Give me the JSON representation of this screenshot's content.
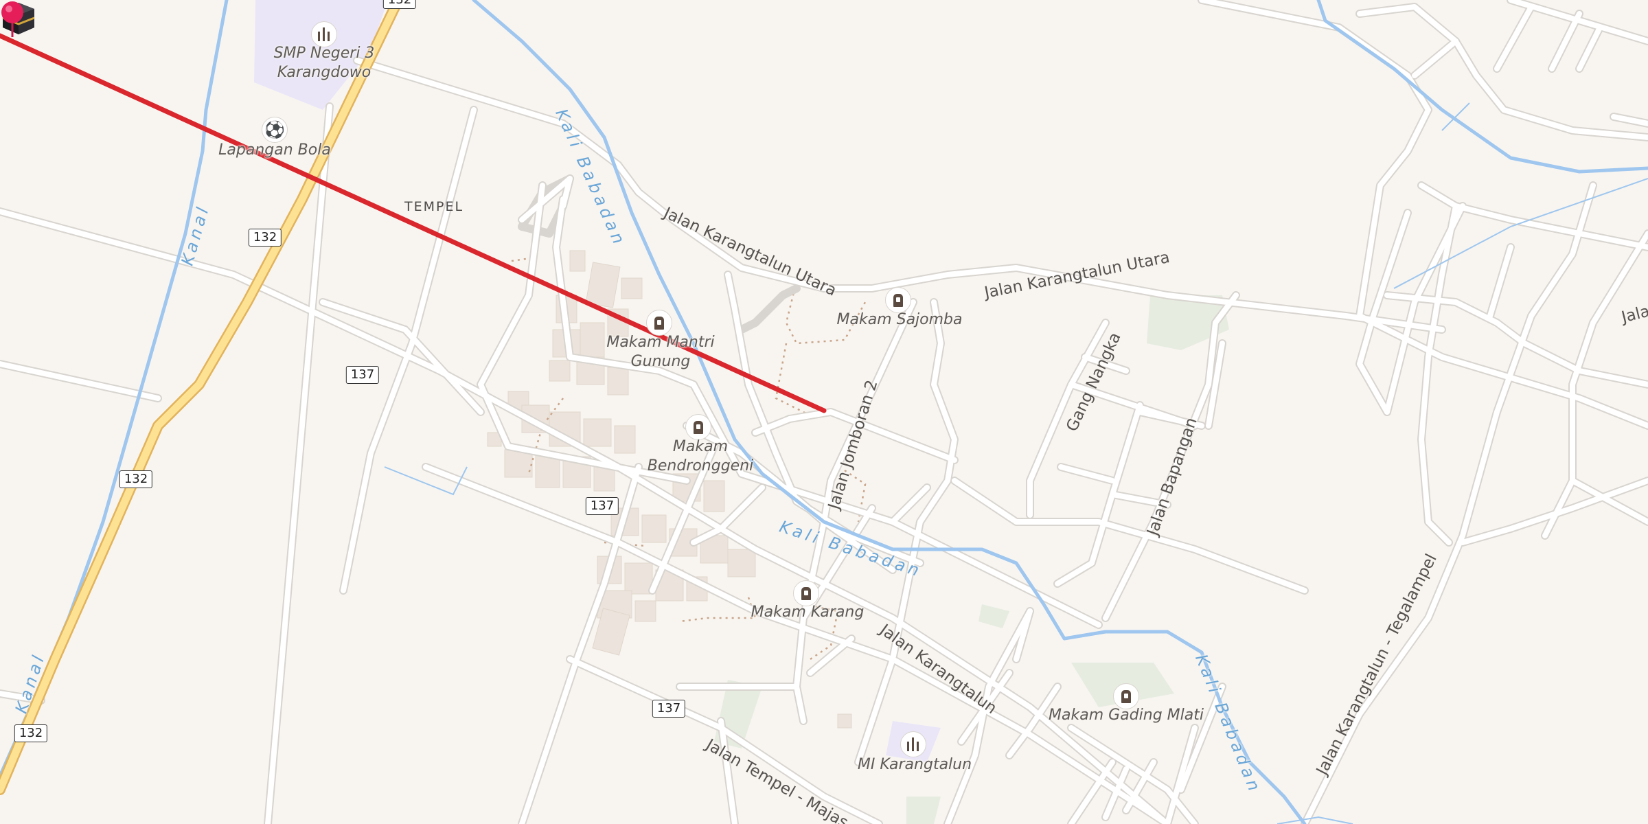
{
  "map": {
    "colors": {
      "background": "#f8f5f1",
      "road": "#ffffff",
      "road_casing": "#d8d4cf",
      "highway": "#fde293",
      "highway_casing": "#e2b35c",
      "water": "#9ec6ee",
      "route_line": "#d9272d",
      "pin": "#e51e59",
      "building": "#ece4dc",
      "green": "#e6ece0",
      "school_area": "#eae6f8"
    },
    "route": {
      "from": "Kaaba (Qibla direction)",
      "to": "Selected location"
    },
    "place_labels": {
      "tempel": "TEMPEL"
    },
    "pois": [
      {
        "id": "smp",
        "name": "SMP Negeri 3\nKarangdowo",
        "icon": "school-icon"
      },
      {
        "id": "lapangan",
        "name": "Lapangan Bola",
        "icon": "soccer-field-icon"
      },
      {
        "id": "mantri",
        "name": "Makam Mantri\nGunung",
        "icon": "cemetery-icon"
      },
      {
        "id": "bendronggeni",
        "name": "Makam\nBendronggeni",
        "icon": "cemetery-icon"
      },
      {
        "id": "sajomba",
        "name": "Makam Sajomba",
        "icon": "cemetery-icon"
      },
      {
        "id": "karang",
        "name": "Makam Karang",
        "icon": "cemetery-icon"
      },
      {
        "id": "gading",
        "name": "Makam Gading Mlati",
        "icon": "cemetery-icon"
      },
      {
        "id": "mi",
        "name": "MI Karangtalun",
        "icon": "school-icon"
      }
    ],
    "streets": {
      "karangtalun_utara_1": "Jalan Karangtalun Utara",
      "karangtalun_utara_2": "Jalan Karangtalun Utara",
      "jomboran": "Jalan Jomboran 2",
      "gang_nangka": "Gang Nangka",
      "bapangan": "Jalan Bapangan",
      "karangtalun": "Jalan Karangtalun",
      "tegalampel": "Jalan Karangtalun - Tegalampel",
      "tempel_majasem": "Jalan Tempel - Majas",
      "jala_edge": "Jala"
    },
    "waterways": {
      "kanal_1": "Kanal",
      "kanal_2": "Kanal",
      "babadan_1": "Kali Babadan",
      "babadan_2": "Kali Babadan",
      "babadan_3": "Kali Babadan"
    },
    "route_shields": {
      "s132_a": "132",
      "s132_b": "132",
      "s132_c": "132",
      "s132_d": "132",
      "s137_a": "137",
      "s137_b": "137",
      "s137_c": "137"
    }
  }
}
